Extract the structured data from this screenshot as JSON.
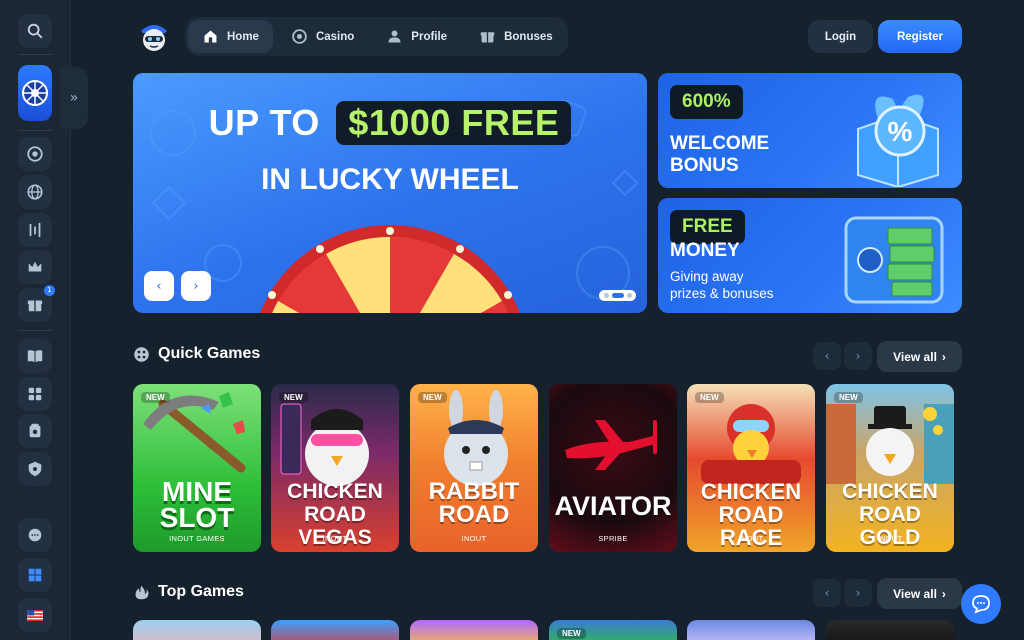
{
  "nav": {
    "tabs": [
      {
        "label": "Home",
        "icon": "home-icon",
        "active": true
      },
      {
        "label": "Casino",
        "icon": "casino-chip-icon",
        "active": false
      },
      {
        "label": "Profile",
        "icon": "user-icon",
        "active": false
      },
      {
        "label": "Bonuses",
        "icon": "gift-icon",
        "active": false
      }
    ]
  },
  "auth": {
    "login_label": "Login",
    "register_label": "Register"
  },
  "sidebar": {
    "notification_count": "1",
    "icons": [
      "search-icon",
      "casino-chip-icon",
      "globe-icon",
      "chart-icon",
      "crown-icon",
      "gift-icon",
      "book-icon",
      "games-icon",
      "wallet-icon",
      "shield-icon",
      "chat-icon",
      "windows-icon",
      "flag-us-icon"
    ]
  },
  "hero": {
    "line1_prefix": "UP TO",
    "line1_highlight": "$1000 FREE",
    "line2": "IN LUCKY WHEEL",
    "colors": {
      "accent": "#b6f36a",
      "bg": "#2d72ec"
    }
  },
  "promos": [
    {
      "tag": "600%",
      "title_line1": "WELCOME",
      "title_line2": "BONUS"
    },
    {
      "tag": "FREE",
      "title_line1": "MONEY",
      "subtitle_line1": "Giving away",
      "subtitle_line2": "prizes & bonuses"
    }
  ],
  "quick_games": {
    "title": "Quick Games",
    "view_all": "View all",
    "games": [
      {
        "badge": "NEW",
        "name": "MINE\nSLOT",
        "provider": "INOUT GAMES",
        "color": "#2fbf3a"
      },
      {
        "badge": "NEW",
        "name": "CHICKEN\nROAD VEGAS",
        "provider": "INOUT",
        "color": "#d9402e"
      },
      {
        "badge": "NEW",
        "name": "RABBIT\nROAD",
        "provider": "INOUT",
        "color": "#e8632a"
      },
      {
        "badge": "",
        "name": "AVIATOR",
        "provider": "SPRIBE",
        "color": "#b0102a"
      },
      {
        "badge": "NEW",
        "name": "CHICKEN\nROAD RACE",
        "provider": "INOUT",
        "color": "#f0a52a"
      },
      {
        "badge": "NEW",
        "name": "CHICKEN\nROAD GOLD",
        "provider": "INOUT",
        "color": "#f2b31f"
      }
    ]
  },
  "top_games": {
    "title": "Top Games",
    "view_all": "View all",
    "first_badge": "NEW"
  }
}
